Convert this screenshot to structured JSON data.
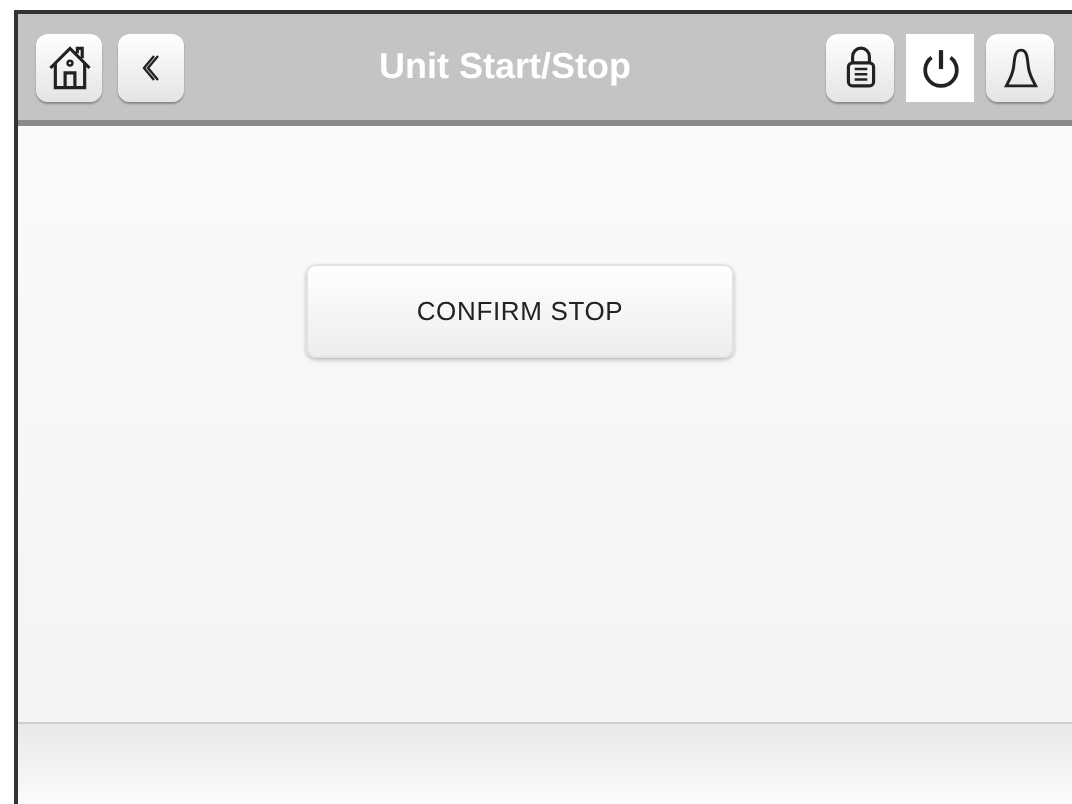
{
  "header": {
    "title": "Unit Start/Stop",
    "left_buttons": [
      {
        "kind": "home",
        "selected": false
      },
      {
        "kind": "back",
        "selected": false
      }
    ],
    "right_buttons": [
      {
        "kind": "lock",
        "selected": false
      },
      {
        "kind": "power",
        "selected": true
      },
      {
        "kind": "bell",
        "selected": false
      }
    ]
  },
  "confirm_button": {
    "label": "CONFIRM STOP"
  }
}
